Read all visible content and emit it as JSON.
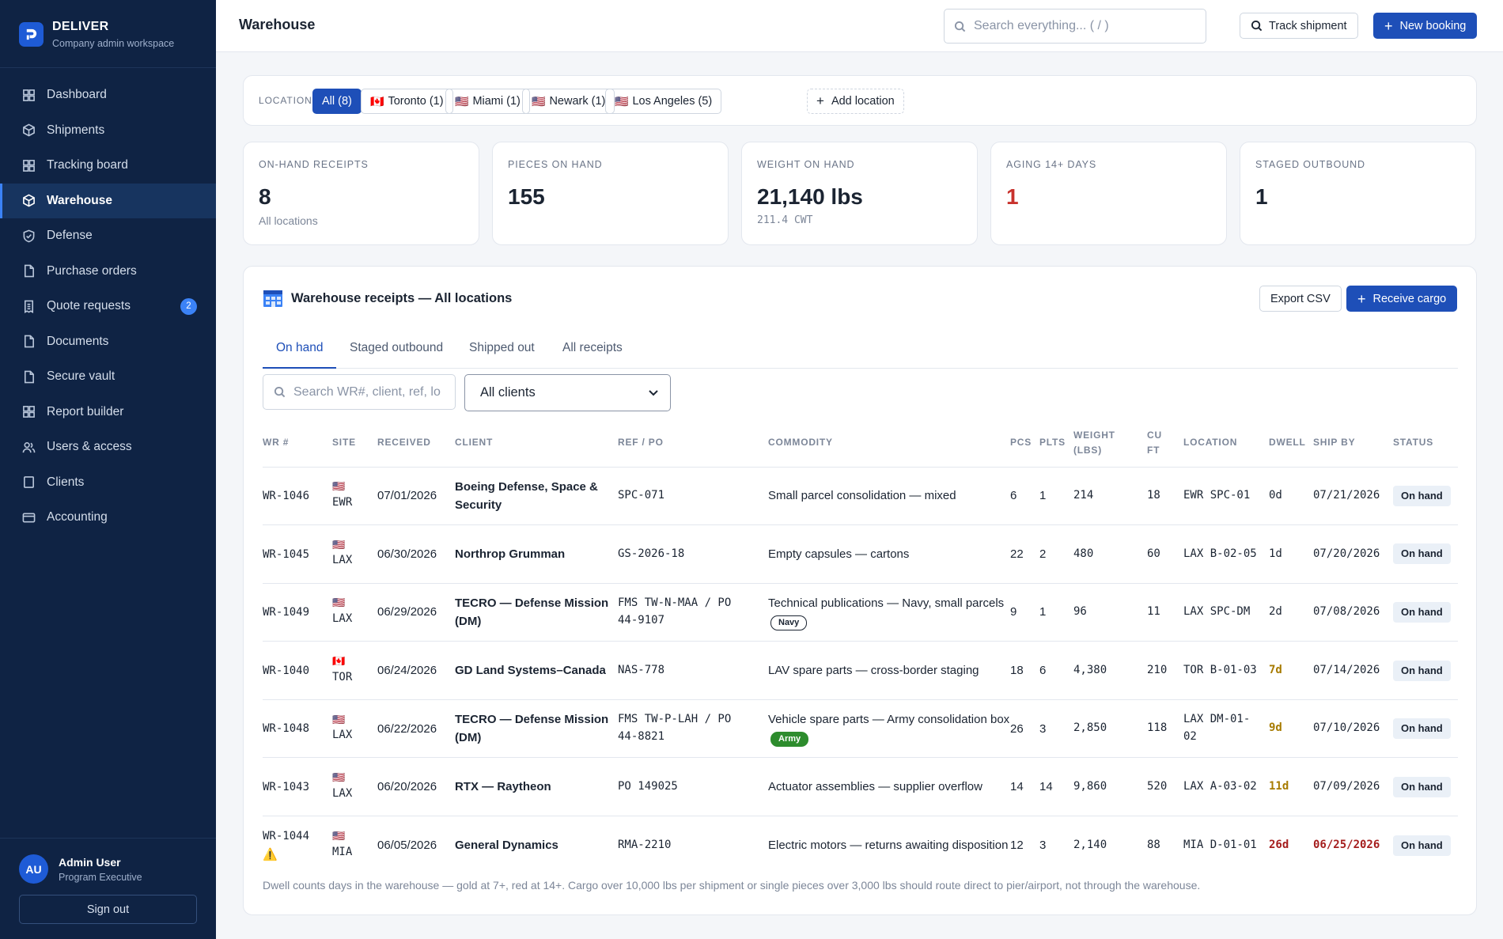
{
  "app": {
    "brand_name": "DELIVER",
    "brand_sub": "Company admin workspace",
    "page_title": "Warehouse"
  },
  "sidebar": {
    "items": [
      {
        "label": "Dashboard",
        "icon": "grid-icon"
      },
      {
        "label": "Shipments",
        "icon": "box-icon"
      },
      {
        "label": "Tracking board",
        "icon": "grid-icon"
      },
      {
        "label": "Warehouse",
        "icon": "box-icon",
        "active": true
      },
      {
        "label": "Defense",
        "icon": "shield-icon"
      },
      {
        "label": "Purchase orders",
        "icon": "document-icon"
      },
      {
        "label": "Quote requests",
        "icon": "receipt-icon",
        "badge": "2"
      },
      {
        "label": "Documents",
        "icon": "document-icon"
      },
      {
        "label": "Secure vault",
        "icon": "document-icon"
      },
      {
        "label": "Report builder",
        "icon": "grid-icon"
      },
      {
        "label": "Users & access",
        "icon": "users-icon"
      },
      {
        "label": "Clients",
        "icon": "square-icon"
      },
      {
        "label": "Accounting",
        "icon": "card-icon"
      }
    ]
  },
  "user": {
    "initials": "AU",
    "name": "Admin User",
    "role": "Program Executive",
    "signout": "Sign out"
  },
  "topbar": {
    "search_placeholder": "Search everything... ( / )",
    "track_label": "Track shipment",
    "new_booking_label": "New booking"
  },
  "locations": {
    "label": "LOCATIONS",
    "chips": [
      {
        "label": "All (8)",
        "flag": ""
      },
      {
        "label": "Toronto (1)",
        "flag": "🇨🇦"
      },
      {
        "label": "Miami (1)",
        "flag": "🇺🇸"
      },
      {
        "label": "Newark (1)",
        "flag": "🇺🇸"
      },
      {
        "label": "Los Angeles (5)",
        "flag": "🇺🇸"
      }
    ],
    "add_label": "Add location"
  },
  "stats": [
    {
      "label": "ON-HAND RECEIPTS",
      "value": "8",
      "sub": "All locations"
    },
    {
      "label": "PIECES ON HAND",
      "value": "155",
      "sub": ""
    },
    {
      "label": "WEIGHT ON HAND",
      "value": "21,140 lbs",
      "sub": "211.4 CWT"
    },
    {
      "label": "AGING 14+ DAYS",
      "value": "1",
      "sub": ""
    },
    {
      "label": "STAGED OUTBOUND",
      "value": "1",
      "sub": ""
    }
  ],
  "receipts": {
    "title": "Warehouse receipts — All locations",
    "export_label": "Export CSV",
    "receive_label": "Receive cargo",
    "tabs": [
      "On hand",
      "Staged outbound",
      "Shipped out",
      "All receipts"
    ],
    "search_placeholder": "Search WR#, client, ref, lo",
    "client_filter": "All clients",
    "columns": [
      "WR #",
      "SITE",
      "RECEIVED",
      "CLIENT",
      "REF / PO",
      "COMMODITY",
      "PCS",
      "PLTS",
      "WEIGHT (LBS)",
      "CU FT",
      "LOCATION",
      "DWELL",
      "SHIP BY",
      "STATUS"
    ],
    "rows": [
      {
        "wr": "WR-1046",
        "warn": "",
        "flag": "🇺🇸",
        "site": "EWR",
        "received": "07/01/2026",
        "client": "Boeing Defense, Space & Security",
        "ref": "SPC-071",
        "commodity": "Small parcel consolidation — mixed",
        "tag": "",
        "pcs": "6",
        "plts": "1",
        "weight": "214",
        "cuft": "18",
        "location": "EWR SPC-01",
        "dwell": "0d",
        "dwell_level": "normal",
        "ship_by": "07/21/2026",
        "ship_late": false,
        "status": "On hand"
      },
      {
        "wr": "WR-1045",
        "warn": "",
        "flag": "🇺🇸",
        "site": "LAX",
        "received": "06/30/2026",
        "client": "Northrop Grumman",
        "ref": "GS-2026-18",
        "commodity": "Empty capsules — cartons",
        "tag": "",
        "pcs": "22",
        "plts": "2",
        "weight": "480",
        "cuft": "60",
        "location": "LAX B-02-05",
        "dwell": "1d",
        "dwell_level": "normal",
        "ship_by": "07/20/2026",
        "ship_late": false,
        "status": "On hand"
      },
      {
        "wr": "WR-1049",
        "warn": "",
        "flag": "🇺🇸",
        "site": "LAX",
        "received": "06/29/2026",
        "client": "TECRO — Defense Mission (DM)",
        "ref": "FMS TW-N-MAA / PO 44-9107",
        "commodity": "Technical publications — Navy, small parcels",
        "tag": "Navy",
        "pcs": "9",
        "plts": "1",
        "weight": "96",
        "cuft": "11",
        "location": "LAX SPC-DM",
        "dwell": "2d",
        "dwell_level": "normal",
        "ship_by": "07/08/2026",
        "ship_late": false,
        "status": "On hand"
      },
      {
        "wr": "WR-1040",
        "warn": "",
        "flag": "🇨🇦",
        "site": "TOR",
        "received": "06/24/2026",
        "client": "GD Land Systems–Canada",
        "ref": "NAS-778",
        "commodity": "LAV spare parts — cross-border staging",
        "tag": "",
        "pcs": "18",
        "plts": "6",
        "weight": "4,380",
        "cuft": "210",
        "location": "TOR B-01-03",
        "dwell": "7d",
        "dwell_level": "gold",
        "ship_by": "07/14/2026",
        "ship_late": false,
        "status": "On hand"
      },
      {
        "wr": "WR-1048",
        "warn": "",
        "flag": "🇺🇸",
        "site": "LAX",
        "received": "06/22/2026",
        "client": "TECRO — Defense Mission (DM)",
        "ref": "FMS TW-P-LAH / PO 44-8821",
        "commodity": "Vehicle spare parts — Army consolidation box",
        "tag": "Army",
        "pcs": "26",
        "plts": "3",
        "weight": "2,850",
        "cuft": "118",
        "location": "LAX DM-01-02",
        "dwell": "9d",
        "dwell_level": "gold",
        "ship_by": "07/10/2026",
        "ship_late": false,
        "status": "On hand"
      },
      {
        "wr": "WR-1043",
        "warn": "",
        "flag": "🇺🇸",
        "site": "LAX",
        "received": "06/20/2026",
        "client": "RTX — Raytheon",
        "ref": "PO 149025",
        "commodity": "Actuator assemblies — supplier overflow",
        "tag": "",
        "pcs": "14",
        "plts": "14",
        "weight": "9,860",
        "cuft": "520",
        "location": "LAX A-03-02",
        "dwell": "11d",
        "dwell_level": "gold",
        "ship_by": "07/09/2026",
        "ship_late": false,
        "status": "On hand"
      },
      {
        "wr": "WR-1044",
        "warn": "⚠️",
        "flag": "🇺🇸",
        "site": "MIA",
        "received": "06/05/2026",
        "client": "General Dynamics",
        "ref": "RMA-2210",
        "commodity": "Electric motors — returns awaiting disposition",
        "tag": "",
        "pcs": "12",
        "plts": "3",
        "weight": "2,140",
        "cuft": "88",
        "location": "MIA D-01-01",
        "dwell": "26d",
        "dwell_level": "red",
        "ship_by": "06/25/2026",
        "ship_late": true,
        "status": "On hand"
      }
    ],
    "footnote": "Dwell counts days in the warehouse — gold at 7+, red at 14+. Cargo over 10,000 lbs per shipment or single pieces over 3,000 lbs should route direct to pier/airport, not through the warehouse."
  },
  "colors": {
    "sidebar_bg": "#0f2344",
    "primary": "#1e4fb8",
    "gold": "#a77b00",
    "red": "#a51d1d",
    "army_green": "#2d8c2d"
  }
}
